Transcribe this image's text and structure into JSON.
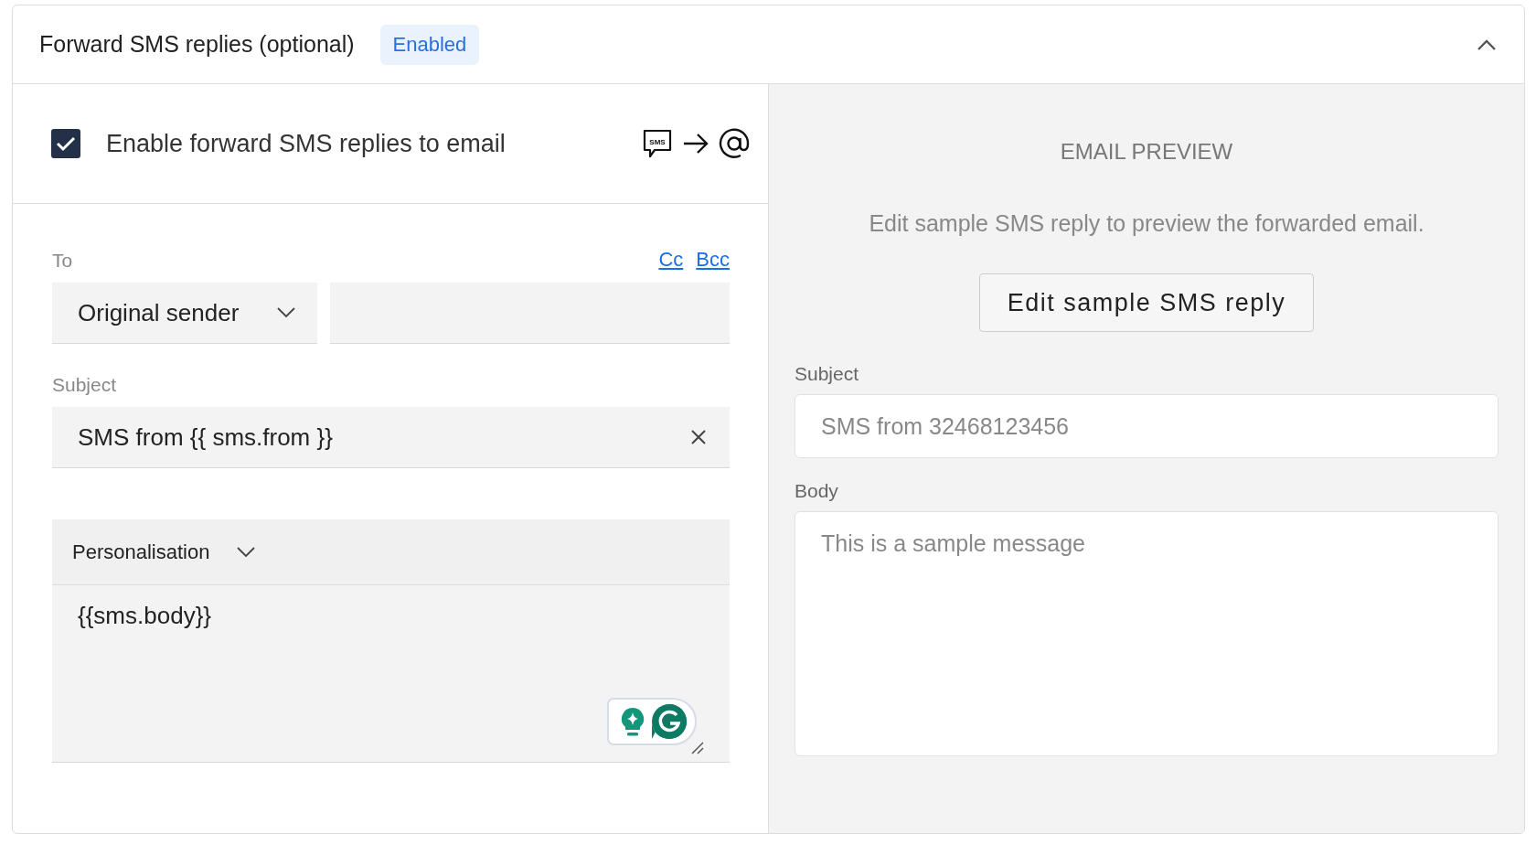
{
  "panel": {
    "title": "Forward SMS replies (optional)",
    "status_badge": "Enabled",
    "expanded": true
  },
  "enable_row": {
    "label": "Enable forward SMS replies to email",
    "checked": true,
    "icon_text": "SMS"
  },
  "form": {
    "to": {
      "label": "To",
      "links": [
        "Cc",
        "Bcc"
      ],
      "select_value": "Original sender"
    },
    "subject": {
      "label": "Subject",
      "value": "SMS from {{ sms.from }}"
    },
    "personalisation": {
      "label": "Personalisation"
    },
    "body": {
      "value": "{{sms.body}}"
    }
  },
  "preview": {
    "heading": "EMAIL PREVIEW",
    "hint": "Edit sample SMS reply to preview the forwarded email.",
    "button": "Edit sample SMS reply",
    "subject": {
      "label": "Subject",
      "value": "SMS from 32468123456"
    },
    "body": {
      "label": "Body",
      "value": "This is a sample message"
    }
  }
}
